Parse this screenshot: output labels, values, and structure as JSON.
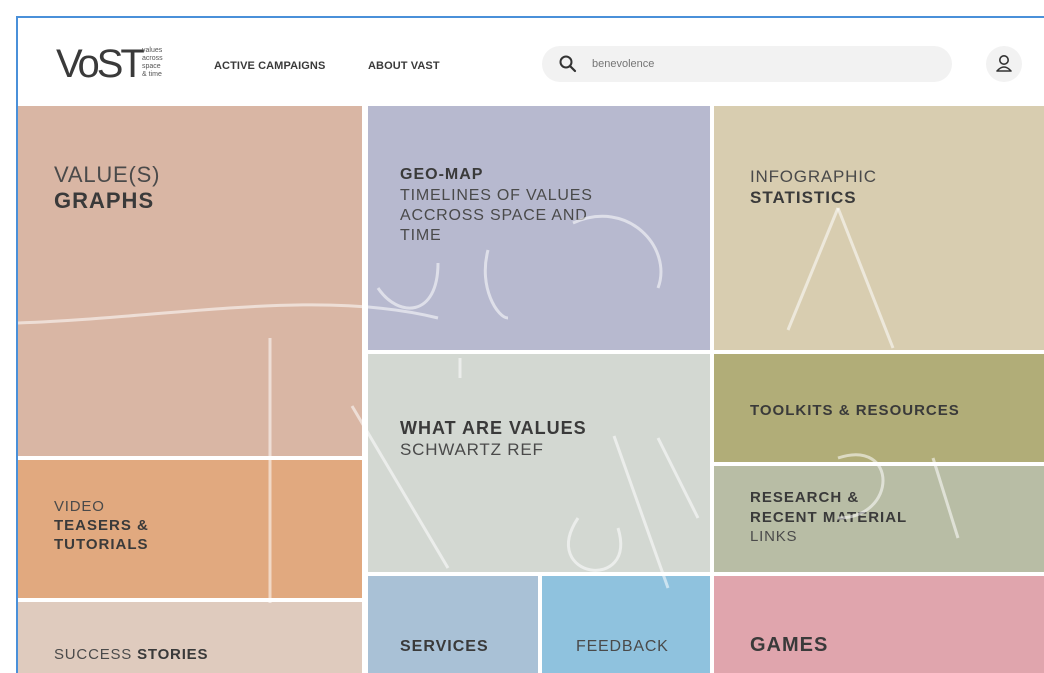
{
  "header": {
    "logo_text": "VoST",
    "logo_tagline": [
      "values",
      "across",
      "space",
      "& time"
    ],
    "nav": [
      "ACTIVE CAMPAIGNS",
      "ABOUT VAST"
    ],
    "search_placeholder": "benevolence",
    "search_icon": "search-icon",
    "user_icon": "user-icon"
  },
  "tiles": {
    "value_graphs": {
      "line1": "VALUE(S)",
      "line2": "GRAPHS",
      "color": "#d9b6a4"
    },
    "geo_map": {
      "title": "GEO-MAP",
      "sub1": "TIMELINES OF VALUES",
      "sub2": "ACCROSS SPACE AND",
      "sub3": "TIME",
      "color": "#b7b9cf"
    },
    "infographic": {
      "line1": "INFOGRAPHIC",
      "line2": "STATISTICS",
      "color": "#d8cdb0"
    },
    "what_are_values": {
      "title": "WHAT ARE VALUES",
      "sub": "SCHWARTZ REF",
      "color": "#d3d8d2"
    },
    "toolkits": {
      "title": "TOOLKITS & RESOURCES",
      "color": "#b1ad78"
    },
    "research": {
      "line1": "RESEARCH &",
      "line2": "RECENT MATERIAL",
      "line3": "LINKS",
      "color": "#b8bda5"
    },
    "video": {
      "line1": "VIDEO",
      "line2": "TEASERS &",
      "line3": "TUTORIALS",
      "color": "#e1a97f"
    },
    "success": {
      "light": "SUCCESS",
      "bold": "STORIES",
      "color": "#dfcbbe"
    },
    "services": {
      "title": "SERVICES",
      "color": "#a9c1d6"
    },
    "feedback": {
      "title": "FEEDBACK",
      "color": "#8fc2de"
    },
    "games": {
      "title": "GAMES",
      "color": "#e0a5ad"
    }
  }
}
